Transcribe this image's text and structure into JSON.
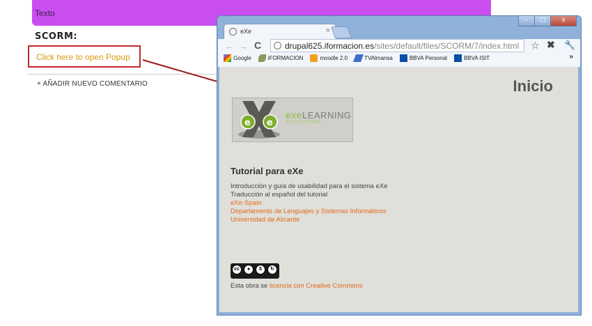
{
  "page": {
    "banner_text": "Texto",
    "scorm_title": "SCORM:",
    "popup_link": "Click here to open Popup",
    "add_comment": "+ AÑADIR NUEVO COMENTARIO"
  },
  "browser": {
    "tab_title": "eXe",
    "tab_close": "×",
    "url_host": "drupal625.iformacion.es",
    "url_path": "/sites/default/files/SCORM/7/index.html",
    "bookmarks": [
      {
        "label": "Google",
        "icon": "google-icon",
        "color": "#4a8af4"
      },
      {
        "label": "iFORMACION",
        "icon": "leaf-icon",
        "color": "#8a9a5b"
      },
      {
        "label": "moodle 2.0",
        "icon": "moodle-icon",
        "color": "#f0a020"
      },
      {
        "label": "TVAlmansa",
        "icon": "tv-icon",
        "color": "#3d6fc8"
      },
      {
        "label": "BBVA Personal",
        "icon": "bank-icon",
        "color": "#0a4fa8"
      },
      {
        "label": "BBVA ISIT",
        "icon": "bank-icon",
        "color": "#0a4fa8"
      }
    ],
    "more": "»",
    "controls": {
      "minimize": "–",
      "maximize": "□",
      "close": "x"
    }
  },
  "content": {
    "title": "Inicio",
    "logo_exe": "exe",
    "logo_word": "LEARNING",
    "logo_sub": "AUTHORING",
    "tutorial_title": "Tutorial para eXe",
    "desc_line1": "Introducción y guía de usabilidad para el sistema eXe",
    "desc_line2": "Traducción al español del tutorial",
    "link1": "eXe-Spain",
    "link2": "Departamento de Lenguajes y Sistemas Informáticos",
    "link3": "Universidad de Alicante",
    "license_prefix": "Esta obra se ",
    "license_link": "licencia con Creative Commons"
  },
  "colors": {
    "banner": "#c94ef0",
    "link_orange": "#e06a1b",
    "popup_link": "#d89a10",
    "highlight_red": "#c0282b"
  }
}
